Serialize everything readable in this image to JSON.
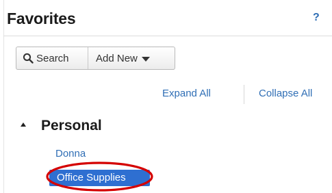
{
  "header": {
    "title": "Favorites",
    "help_label": "?"
  },
  "toolbar": {
    "search_label": "Search",
    "add_new_label": "Add New"
  },
  "actions": {
    "expand_all": "Expand All",
    "collapse_all": "Collapse All"
  },
  "tree": {
    "group_label": "Personal",
    "items": [
      {
        "label": "Donna",
        "selected": false
      },
      {
        "label": "Office Supplies",
        "selected": true
      }
    ]
  },
  "colors": {
    "link": "#2f6eb5",
    "selected_bg": "#2e6fd1",
    "highlight_ellipse": "#d40000"
  },
  "icons": {
    "search": "search-icon",
    "dropdown": "caret-down-icon",
    "tree_toggle": "expand-arrow-icon"
  }
}
